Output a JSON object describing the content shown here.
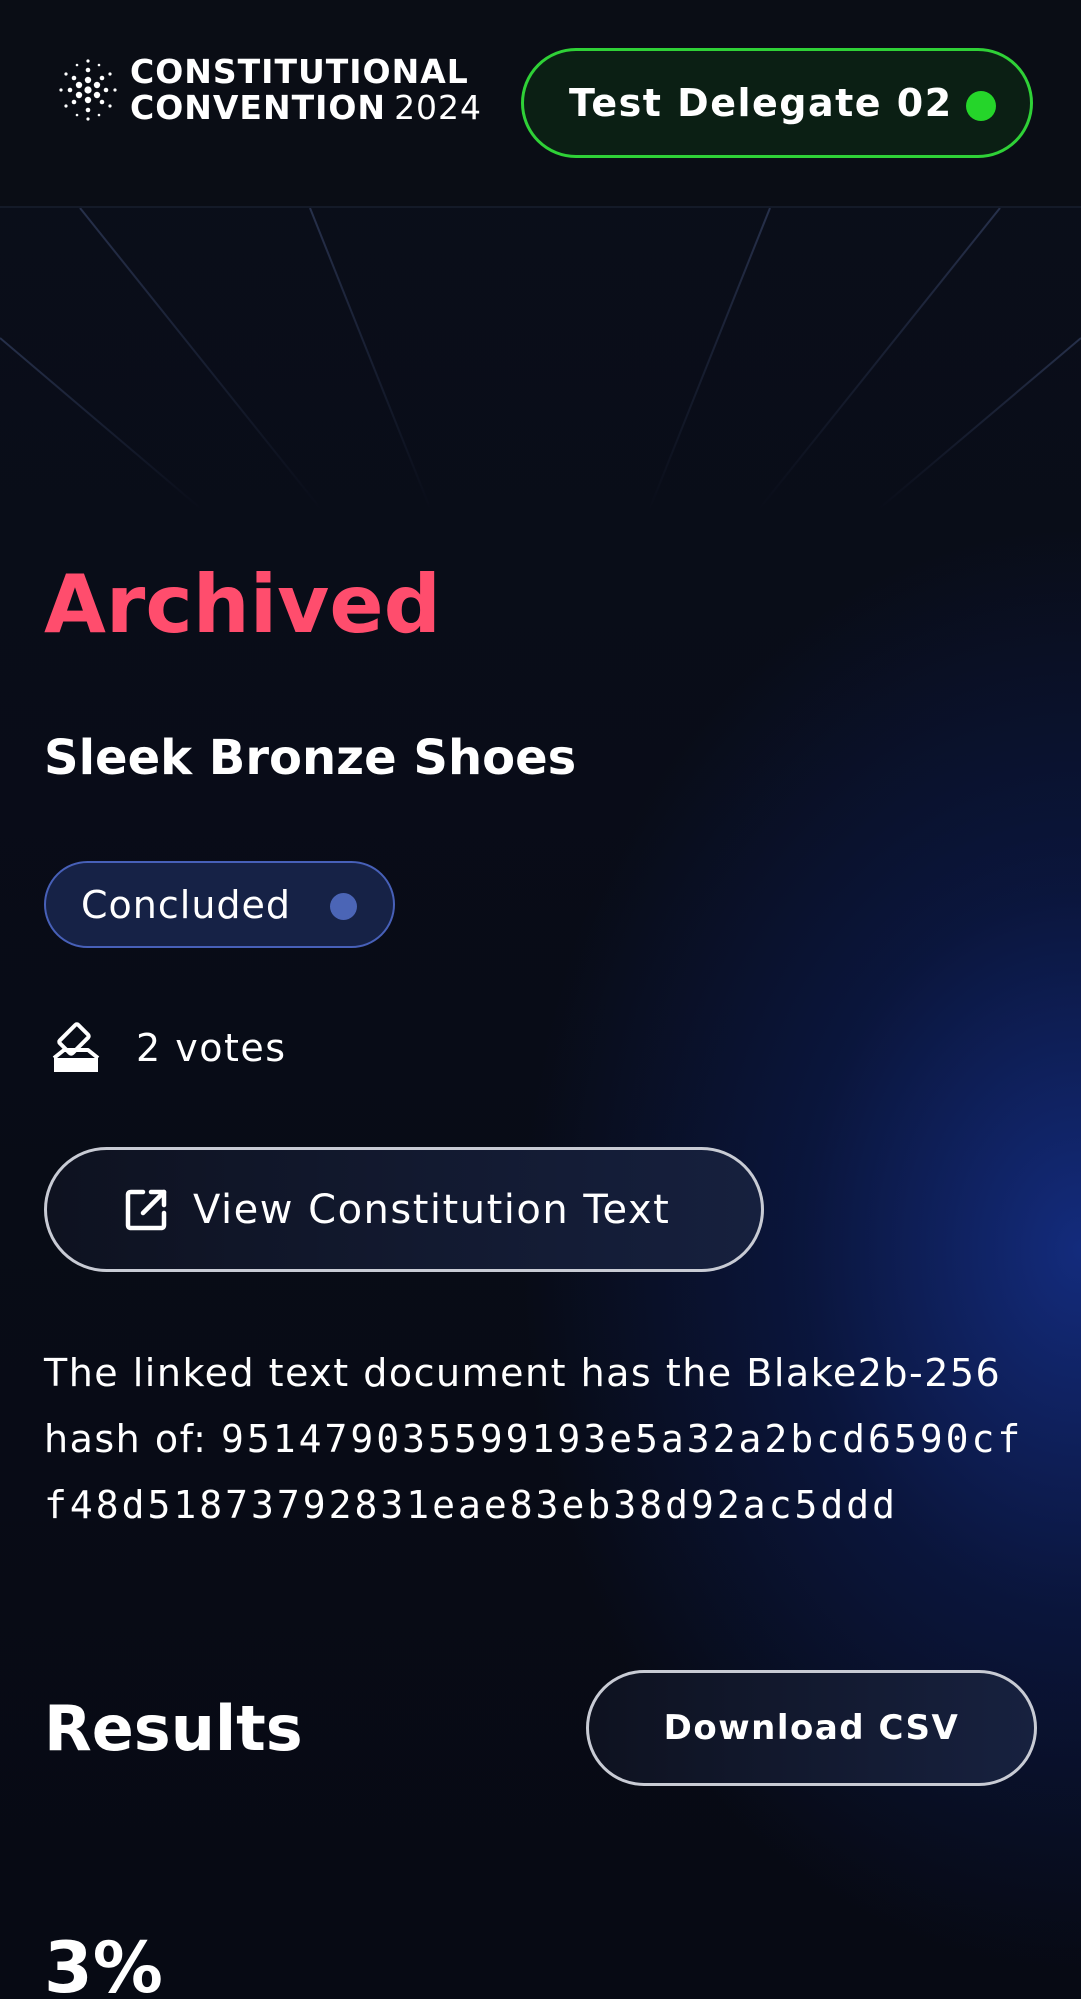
{
  "header": {
    "logo": {
      "line1": "CONSTITUTIONAL",
      "line2_bold": "CONVENTION",
      "line2_light": "2024"
    },
    "delegate": {
      "name": "Test Delegate 02",
      "status_color": "#25d52a"
    }
  },
  "main": {
    "status_heading": "Archived",
    "status_heading_color": "#ff4d6d",
    "proposal_title": "Sleek Bronze Shoes",
    "badge": {
      "label": "Concluded",
      "dot_color": "#4b65b6"
    },
    "votes": {
      "icon": "ballot-box-icon",
      "text": "2 votes"
    },
    "view_text_button": {
      "icon": "external-link-icon",
      "label": "View Constitution Text"
    },
    "hash": {
      "intro": "The linked text document has the Blake2b-256 hash of:",
      "value": "951479035599193e5a32a2bcd6590cff48d51873792831eae83eb38d92ac5ddd"
    }
  },
  "results": {
    "heading": "Results",
    "download_label": "Download CSV",
    "percent": "3%"
  }
}
